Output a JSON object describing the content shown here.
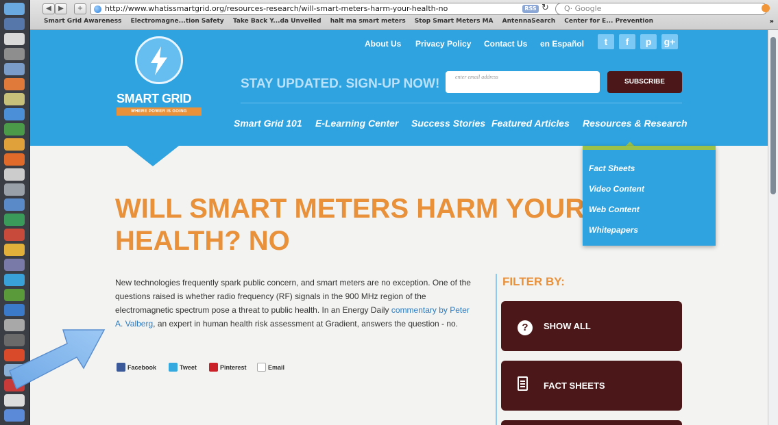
{
  "browser": {
    "url": "http://www.whatissmartgrid.org/resources-research/will-smart-meters-harm-your-health-no",
    "rss_label": "RSS",
    "reload_icon": "reload-icon",
    "search_placeholder": "Q· Google",
    "bookmarks": [
      "Smart Grid Awareness",
      "Electromagne...tion Safety",
      "Take Back Y...da Unveiled",
      "halt ma smart meters",
      "Stop Smart Meters MA",
      "AntennaSearch",
      "Center for E... Prevention"
    ],
    "bookmarks_more": "»"
  },
  "site": {
    "logo_title": "SMART GRID",
    "logo_tagline": "WHERE POWER IS GOING",
    "top_links": [
      "About Us",
      "Privacy Policy",
      "Contact Us",
      "en Español"
    ],
    "social": [
      "twitter-icon",
      "facebook-icon",
      "pinterest-icon",
      "googleplus-icon"
    ],
    "signup_text": "STAY UPDATED. SIGN-UP NOW!",
    "email_placeholder": "enter email address",
    "subscribe_label": "SUBSCRIBE",
    "nav": [
      "Smart Grid 101",
      "E-Learning Center",
      "Success Stories",
      "Featured Articles",
      "Resources & Research"
    ],
    "dropdown": [
      "Fact Sheets",
      "Video Content",
      "Web Content",
      "Whitepapers"
    ]
  },
  "article": {
    "title_line1": "WILL SMART METERS HARM YOUR",
    "title_line2": "HEALTH? NO",
    "p1": "New technologies frequently spark public concern, and smart meters are no exception. One of the questions raised is whether radio frequency (RF) signals in the 900 MHz region of the electromagnetic spectrum pose a threat to public health. In an Energy Daily ",
    "link": "commentary by Peter A. Valberg",
    "p2": ", an expert in human health risk assessment at Gradient, answers the question - no.",
    "share": [
      "Facebook",
      "Tweet",
      "Pinterest",
      "Email"
    ]
  },
  "filter": {
    "heading": "FILTER BY:",
    "buttons": [
      "SHOW ALL",
      "FACT SHEETS"
    ]
  },
  "colors": {
    "brand_blue": "#2ea3e0",
    "accent_orange": "#e8903a",
    "button_maroon": "#4c1719",
    "dropdown_accent": "#9bc14a"
  }
}
